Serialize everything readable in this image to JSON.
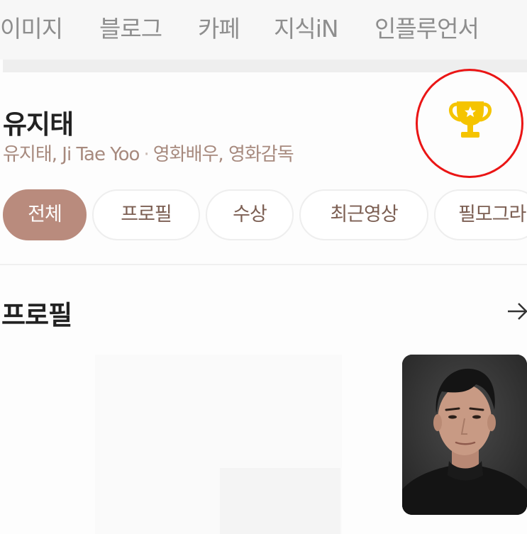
{
  "nav": {
    "items": [
      "이미지",
      "블로그",
      "카페",
      "지식iN",
      "인플루언서"
    ]
  },
  "profile": {
    "name": "유지태",
    "names_line": "유지태, Ji Tae Yoo",
    "separator": "·",
    "occupation": "영화배우, 영화감독",
    "award_icon": "trophy-icon",
    "photo_alt": "profile-photo"
  },
  "tabs": [
    {
      "label": "전체",
      "active": true
    },
    {
      "label": "프로필",
      "active": false
    },
    {
      "label": "수상",
      "active": false
    },
    {
      "label": "최근영상",
      "active": false
    },
    {
      "label": "필모그라",
      "active": false
    }
  ],
  "section": {
    "title": "프로필",
    "more_icon": "arrow-right-icon"
  },
  "colors": {
    "accent": "#b98b7d",
    "highlight_ring": "#ea1515",
    "trophy": "#f5c400",
    "subtext": "#a78a7e"
  }
}
